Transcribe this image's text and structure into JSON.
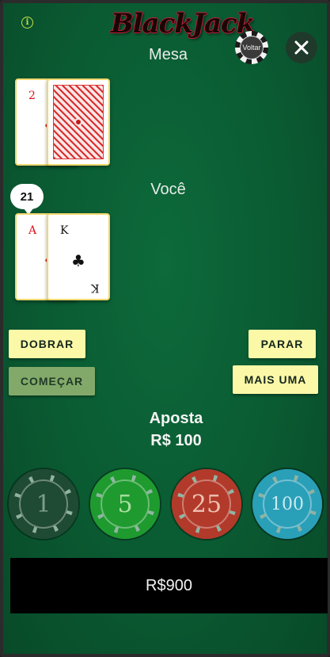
{
  "header": {
    "logo_text": "BlackJack",
    "back_label": "Voltar",
    "close_icon": "close-icon",
    "info_icon": "info-icon"
  },
  "dealer": {
    "label": "Mesa",
    "cards": [
      {
        "rank": "2",
        "suit": "♦",
        "color": "red",
        "face": "up"
      },
      {
        "face": "down"
      }
    ]
  },
  "player": {
    "label": "Você",
    "score": "21",
    "cards": [
      {
        "rank": "A",
        "suit": "♦",
        "color": "red"
      },
      {
        "rank": "K",
        "suit": "♣",
        "color": "black"
      }
    ]
  },
  "actions": {
    "double": "DOBRAR",
    "stand": "PARAR",
    "start": "COMEÇAR",
    "hit": "MAIS UMA"
  },
  "bet": {
    "label": "Aposta",
    "value": "R$ 100"
  },
  "chips": [
    {
      "value": "1",
      "color": "#1f4a33",
      "text_color": "#7d9d88"
    },
    {
      "value": "5",
      "color": "#1f9a2f",
      "text_color": "#a9e0a1"
    },
    {
      "value": "25",
      "color": "#b23a2a",
      "text_color": "#eec1b3"
    },
    {
      "value": "100",
      "color": "#2a9fb8",
      "text_color": "#c7ecf3"
    }
  ],
  "balance": "R$900",
  "colors": {
    "table": "#0a5a32",
    "button_yellow": "#fbf8a8",
    "button_disabled": "#83a96a",
    "card_border": "#f0d86e"
  }
}
